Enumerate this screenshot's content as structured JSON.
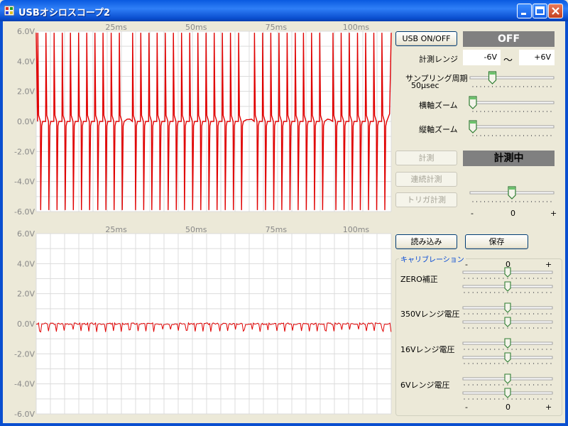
{
  "window": {
    "title": "USBオシロスコープ2"
  },
  "chart_data": [
    {
      "type": "line",
      "title": "",
      "xlabel": "",
      "ylabel": "",
      "x_ticks": [
        "25ms",
        "50ms",
        "75ms",
        "100ms"
      ],
      "y_ticks": [
        "6.0V",
        "4.0V",
        "2.0V",
        "0.0V",
        "-2.0V",
        "-4.0V",
        "-6.0V"
      ],
      "ylim": [
        -6,
        6
      ],
      "xlim_ms": [
        0,
        111
      ],
      "grid": true,
      "series": [
        {
          "color": "#e00000",
          "shape": "square-wave spikes between about -6V and +6V, baseline near 0V"
        }
      ]
    },
    {
      "type": "line",
      "title": "",
      "xlabel": "",
      "ylabel": "",
      "x_ticks": [
        "25ms",
        "50ms",
        "75ms",
        "100ms"
      ],
      "y_ticks": [
        "6.0V",
        "4.0V",
        "2.0V",
        "0.0V",
        "-2.0V",
        "-4.0V",
        "-6.0V"
      ],
      "ylim": [
        -6,
        6
      ],
      "xlim_ms": [
        0,
        111
      ],
      "grid": true,
      "series": [
        {
          "color": "#e00000",
          "shape": "noise near 0V with small negative spikes"
        }
      ]
    }
  ],
  "controls": {
    "usb_button": "USB ON/OFF",
    "usb_status": "OFF",
    "range_label": "計測レンジ",
    "range_min": "-6V",
    "range_sep": "〜",
    "range_max": "+6V",
    "sampling_label": "サンプリング周期",
    "sampling_value": "50μsec",
    "sampling_level": 0.25,
    "hzoom_label": "横軸ズーム",
    "hzoom_level": 0.0,
    "vzoom_label": "縦軸ズーム",
    "vzoom_level": 0.0,
    "measure_button": "計測",
    "measure_status": "計測中",
    "continuous_button": "連続計測",
    "trigger_button": "トリガ計測",
    "trigger_level": 0.5,
    "trigger_minus": "-",
    "trigger_zero": "0",
    "trigger_plus": "+",
    "load_button": "読み込み",
    "save_button": "保存",
    "calibration_title": "キャリブレーション",
    "cal_minus": "-",
    "cal_zero": "0",
    "cal_plus": "+",
    "cal_rows": [
      "ZERO補正",
      "350Vレンジ電圧",
      "16Vレンジ電圧",
      "6Vレンジ電圧"
    ]
  },
  "colors": {
    "trace": "#e00000",
    "grid": "#d8d8d8",
    "titlebar": "#0a5ae0",
    "status_bg": "#808080"
  },
  "icons": {
    "app": "oscilloscope-app-icon",
    "minimize": "minimize-icon",
    "maximize": "maximize-icon",
    "close": "close-icon"
  }
}
